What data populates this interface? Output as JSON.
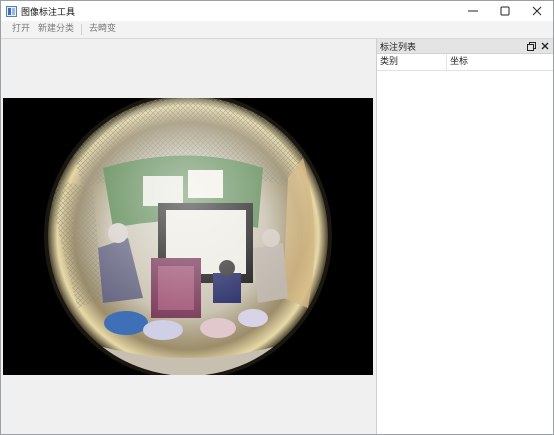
{
  "window": {
    "title": "图像标注工具",
    "icon": "app-image-icon"
  },
  "toolbar": {
    "open_label": "打开",
    "new_category_label": "新建分类",
    "undistort_label": "去畸变"
  },
  "dock": {
    "title": "标注列表",
    "columns": [
      "类别",
      "坐标"
    ]
  },
  "image": {
    "description_icon": "fisheye-photo"
  }
}
